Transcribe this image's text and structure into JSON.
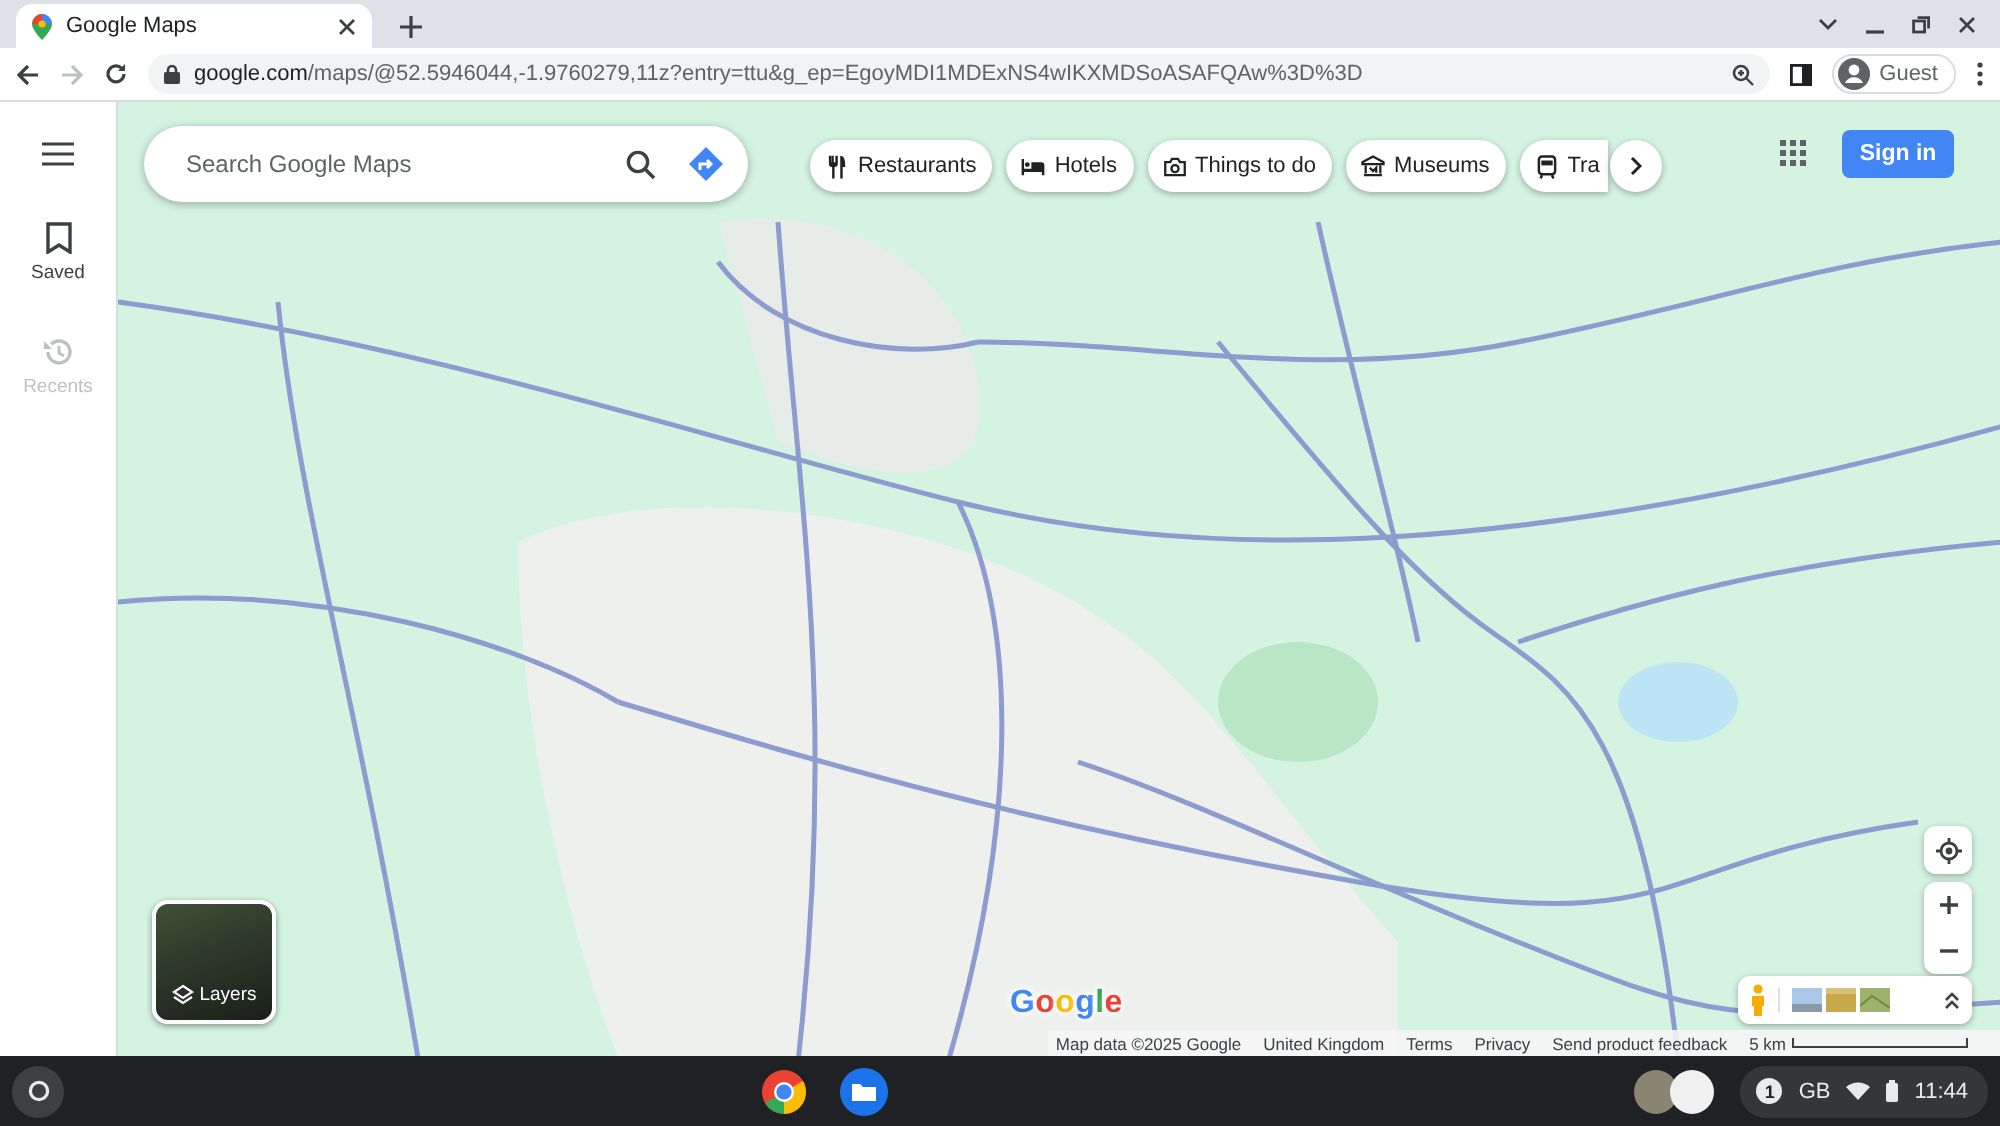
{
  "browser": {
    "tab": {
      "title": "Google Maps",
      "selected": true
    },
    "address": {
      "host": "google.com",
      "path": "/maps/@52.5946044,-1.9760279,11z?entry=ttu&g_ep=EgoyMDI1MDExNS4wIKXMDSoASAFQAw%3D%3D"
    },
    "profile": "Guest"
  },
  "sidebar": {
    "items": [
      {
        "label": "Saved",
        "kind": "saved",
        "disabled": false
      },
      {
        "label": "Recents",
        "kind": "recents",
        "disabled": true
      }
    ]
  },
  "search": {
    "placeholder": "Search Google Maps"
  },
  "chips": [
    {
      "label": "Restaurants",
      "kind": "restaurant"
    },
    {
      "label": "Hotels",
      "kind": "hotel"
    },
    {
      "label": "Things to do",
      "kind": "camera"
    },
    {
      "label": "Museums",
      "kind": "museum"
    },
    {
      "label": "Tra",
      "kind": "transit"
    }
  ],
  "sign_in": "Sign in",
  "layers": {
    "label": "Layers"
  },
  "logo": "Google",
  "attribution": [
    "Map data ©2025 Google",
    "United Kingdom",
    "Terms",
    "Privacy",
    "Send product feedback"
  ],
  "scale": "5 km",
  "taskbar": {
    "notifications": "1",
    "keyboard": "GB",
    "time": "11:44"
  }
}
